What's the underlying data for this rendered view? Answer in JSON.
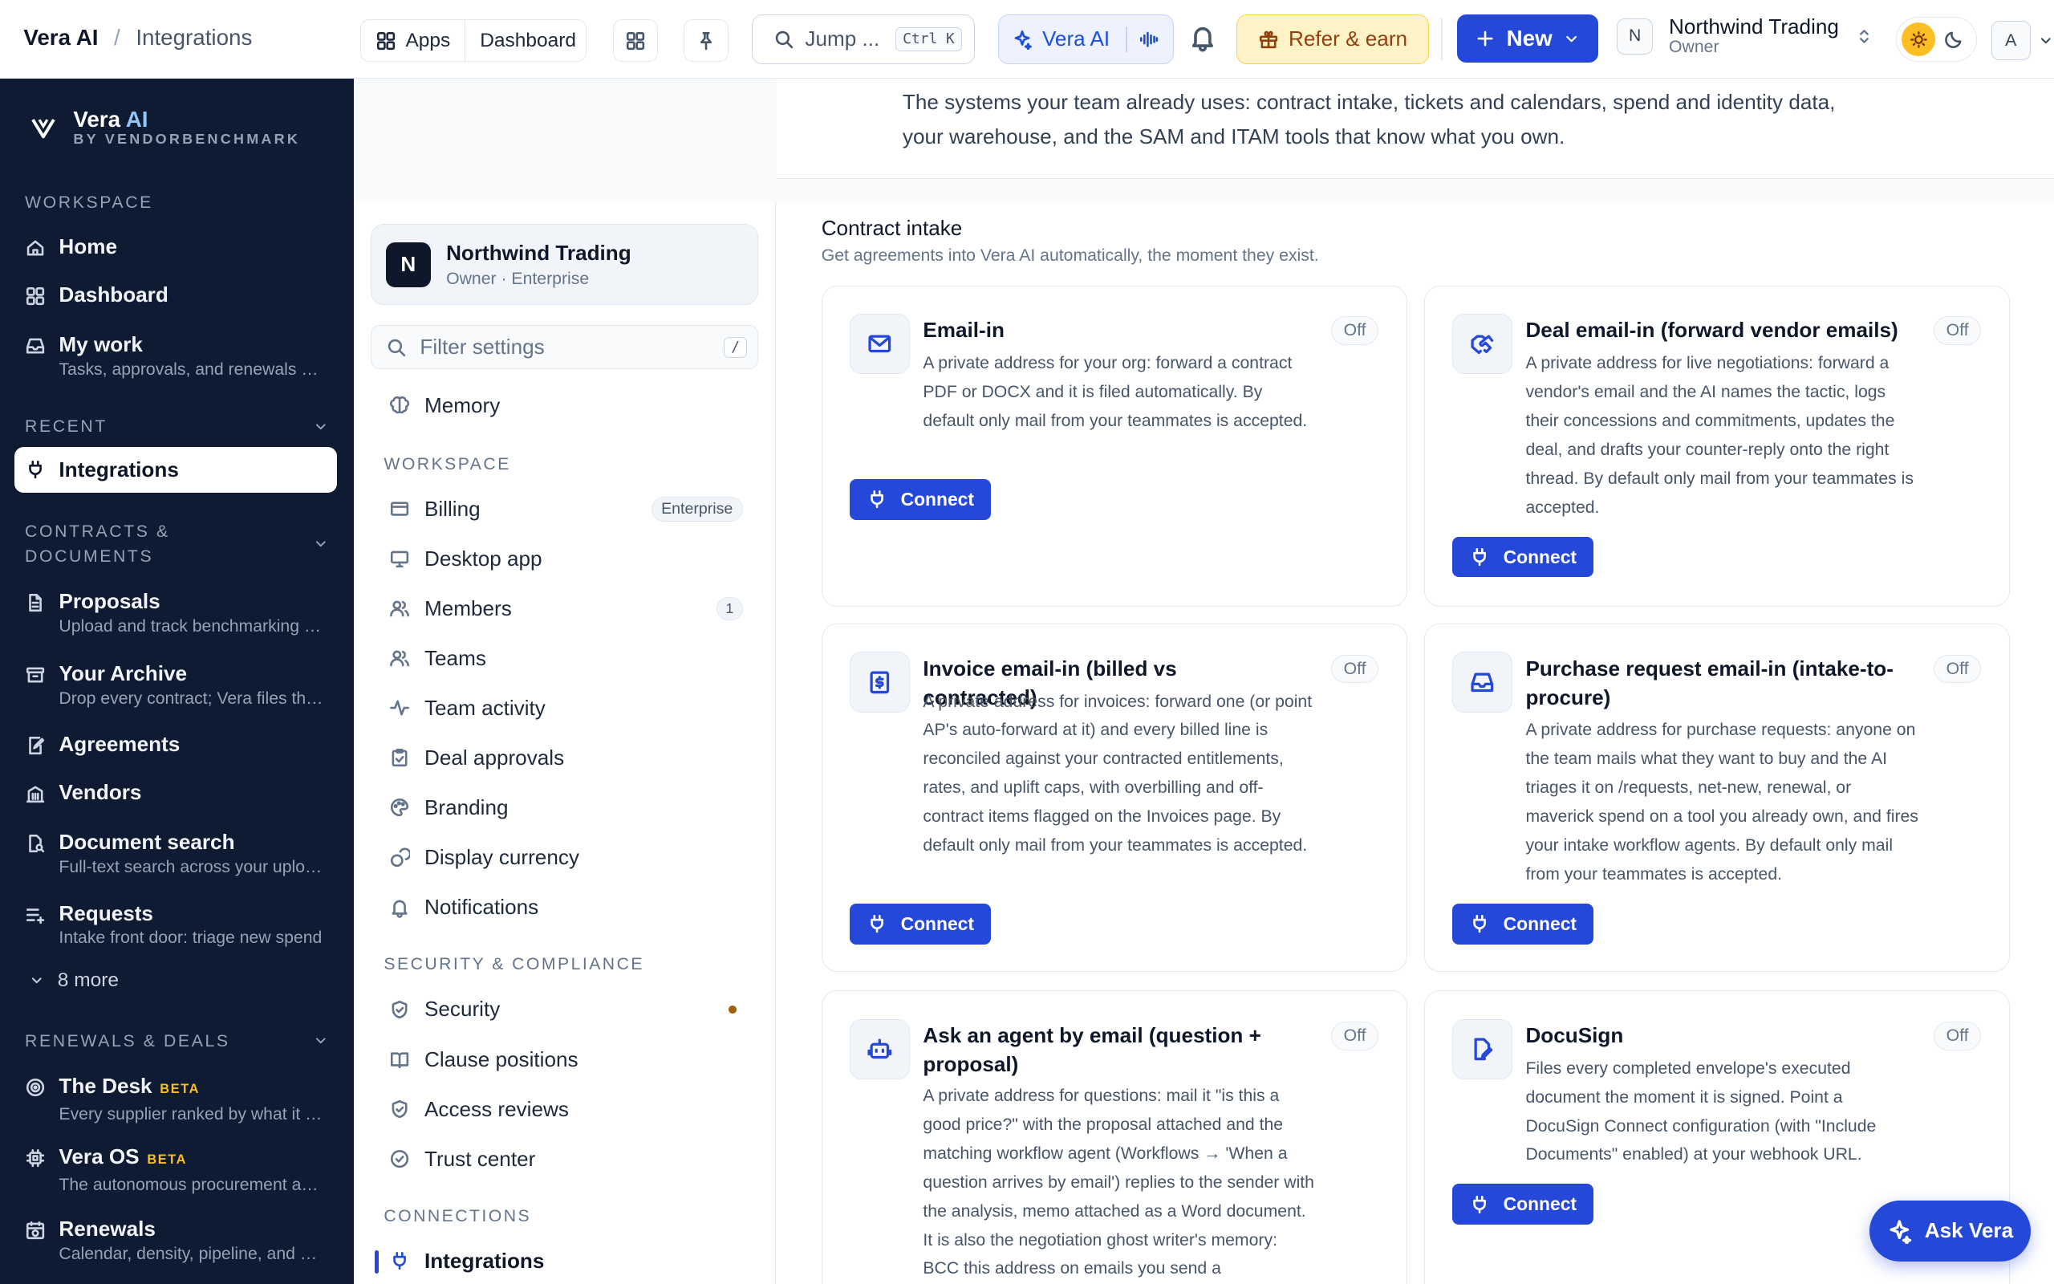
{
  "topbar": {
    "app": "Vera AI",
    "page": "Integrations",
    "apps_label": "Apps",
    "dashboard_label": "Dashboard",
    "search_placeholder": "Jump ...",
    "search_shortcut": "Ctrl K",
    "vera_label": "Vera AI",
    "refer_label": "Refer & earn",
    "new_label": "New",
    "org_initial": "N",
    "org_name": "Northwind Trading",
    "org_role": "Owner",
    "user_initial": "A"
  },
  "sidebar": {
    "brand_name": "Vera",
    "brand_ai": "AI",
    "brand_sub": "BY VENDORBENCHMARK",
    "workspace_header": "WORKSPACE",
    "recent_header": "RECENT",
    "contracts_header": "CONTRACTS & DOCUMENTS",
    "renewals_header": "RENEWALS & DEALS",
    "more_label": "8 more",
    "items": {
      "home": "Home",
      "dashboard": "Dashboard",
      "mywork": "My work",
      "mywork_desc": "Tasks, approvals, and renewals due",
      "integrations": "Integrations",
      "proposals": "Proposals",
      "proposals_desc": "Upload and track benchmarking requests",
      "archive": "Your Archive",
      "archive_desc": "Drop every contract; Vera files them",
      "agreements": "Agreements",
      "vendors": "Vendors",
      "docsearch": "Document search",
      "docsearch_desc": "Full-text search across your uploads",
      "requests": "Requests",
      "requests_desc": "Intake front door: triage new spend",
      "desk": "The Desk",
      "desk_badge": "BETA",
      "desk_desc": "Every supplier ranked by what it costs",
      "veraos": "Vera OS",
      "veraos_badge": "BETA",
      "veraos_desc": "The autonomous procurement agent",
      "renewals": "Renewals",
      "renewals_desc": "Calendar, density, pipeline, and alerts"
    }
  },
  "settings": {
    "org_initial": "N",
    "org_name": "Northwind Trading",
    "org_meta": "Owner · Enterprise",
    "filter_placeholder": "Filter settings",
    "filter_shortcut": "/",
    "memory": "Memory",
    "workspace_header": "WORKSPACE",
    "billing": "Billing",
    "billing_badge": "Enterprise",
    "desktop": "Desktop app",
    "members": "Members",
    "members_count": "1",
    "teams": "Teams",
    "team_activity": "Team activity",
    "deal_approvals": "Deal approvals",
    "branding": "Branding",
    "display_currency": "Display currency",
    "notifications": "Notifications",
    "security_header": "SECURITY & COMPLIANCE",
    "security": "Security",
    "clause_positions": "Clause positions",
    "access_reviews": "Access reviews",
    "trust_center": "Trust center",
    "connections_header": "CONNECTIONS",
    "integrations": "Integrations"
  },
  "main": {
    "intro_line1": "The systems your team already uses: contract intake, tickets and calendars, spend and identity data,",
    "intro_line2": "your warehouse, and the SAM and ITAM tools that know what you own.",
    "section_title": "Contract intake",
    "section_subtitle": "Get agreements into Vera AI automatically, the moment they exist.",
    "connect_label": "Connect",
    "off_label": "Off",
    "cards": [
      {
        "title": "Email-in",
        "desc": "A private address for your org: forward a contract PDF or DOCX and it is filed automatically. By default only mail from your teammates is accepted."
      },
      {
        "title": "Deal email-in (forward vendor emails)",
        "desc": "A private address for live negotiations: forward a vendor's email and the AI names the tactic, logs their concessions and commitments, updates the deal, and drafts your counter-reply onto the right thread. By default only mail from your teammates is accepted."
      },
      {
        "title": "Invoice email-in (billed vs contracted)",
        "desc": "A private address for invoices: forward one (or point AP's auto-forward at it) and every billed line is reconciled against your contracted entitlements, rates, and uplift caps, with overbilling and off-contract items flagged on the Invoices page. By default only mail from your teammates is accepted."
      },
      {
        "title": "Purchase request email-in (intake-to-procure)",
        "desc": "A private address for purchase requests: anyone on the team mails what they want to buy and the AI triages it on /requests, net-new, renewal, or maverick spend on a tool you already own, and fires your intake workflow agents. By default only mail from your teammates is accepted."
      },
      {
        "title": "Ask an agent by email (question + proposal)",
        "desc": "A private address for questions: mail it \"is this a good price?\" with the proposal attached and the matching workflow agent (Workflows → 'When a question arrives by email') replies to the sender with the analysis, memo attached as a Word document. It is also the negotiation ghost writer's memory: BCC this address on emails you send a"
      },
      {
        "title": "DocuSign",
        "desc": "Files every completed envelope's executed document the moment it is signed. Point a DocuSign Connect configuration (with \"Include Documents\" enabled) at your webhook URL."
      }
    ]
  },
  "ask_label": "Ask Vera",
  "colors": {
    "accent": "#2548d8",
    "sidebar": "#0f1b33",
    "beta": "#fbbf24"
  }
}
